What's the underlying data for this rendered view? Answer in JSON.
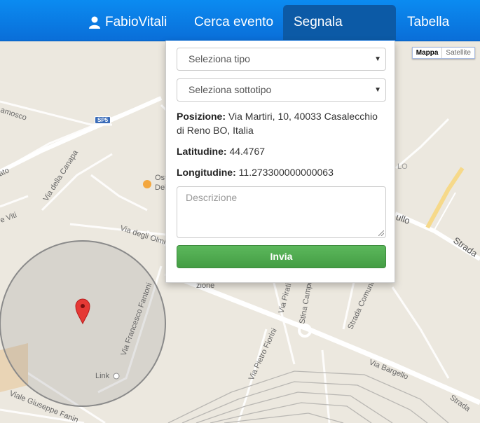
{
  "navbar": {
    "user_label": "FabioVitali",
    "search_label": "Cerca evento",
    "report_label": "Segnala evento",
    "table_label": "Tabella"
  },
  "form": {
    "type_select": "Seleziona tipo",
    "subtype_select": "Seleziona sottotipo",
    "position_label": "Posizione:",
    "position_value": "Via Martiri, 10, 40033 Casalecchio di Reno BO, Italia",
    "latitude_label": "Latitudine:",
    "latitude_value": "44.4767",
    "longitude_label": "Longitudine:",
    "longitude_value": "11.273300000000063",
    "description_placeholder": "Descrizione",
    "submit_label": "Invia"
  },
  "map": {
    "type_map": "Mappa",
    "type_satellite": "Satellite",
    "road_shield": "SP5",
    "labels": {
      "amosco": "amosco",
      "ato": "ato",
      "via_canapa": "Via della Canapa",
      "ost": "Ost",
      "del": "Del",
      "viti": "e Viti",
      "olmi": "Via degli Olmi",
      "lo": "LO",
      "ullo": "ullo",
      "strada": "Strada",
      "zione": "zione",
      "fantoni": "Via Francesco Fantoni",
      "pirati": "Via Pirati",
      "campo": "Stina Campo",
      "comunale": "Strada Comunale",
      "fiorini": "Via Pietro Fiorini",
      "bargello": "Via Bargello",
      "link": "Link",
      "fanin": "Viale Giuseppe Fanin",
      "strada2": "Strada"
    },
    "accent_color": "#0a6ed8",
    "marker_color": "#e53935"
  }
}
